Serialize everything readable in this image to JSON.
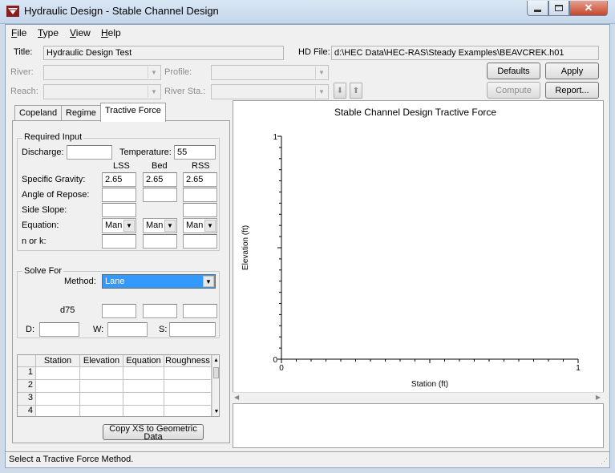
{
  "window": {
    "title": "Hydraulic Design - Stable Channel Design"
  },
  "menu": [
    {
      "label": "File"
    },
    {
      "label": "Type"
    },
    {
      "label": "View"
    },
    {
      "label": "Help"
    }
  ],
  "header": {
    "title_label": "Title:",
    "title_value": "Hydraulic Design Test",
    "hd_file_label": "HD File:",
    "hd_file_value": "d:\\HEC Data\\HEC-RAS\\Steady Examples\\BEAVCREK.h01",
    "river_label": "River:",
    "profile_label": "Profile:",
    "reach_label": "Reach:",
    "river_sta_label": "River Sta.:"
  },
  "buttons": {
    "defaults": "Defaults",
    "apply": "Apply",
    "compute": "Compute",
    "report": "Report..."
  },
  "tabs": [
    {
      "label": "Copeland"
    },
    {
      "label": "Regime"
    },
    {
      "label": "Tractive Force"
    }
  ],
  "required_input": {
    "group_title": "Required Input",
    "discharge_label": "Discharge:",
    "discharge_value": "",
    "temperature_label": "Temperature:",
    "temperature_value": "55",
    "col_lss": "LSS",
    "col_bed": "Bed",
    "col_rss": "RSS",
    "specific_gravity_label": "Specific Gravity:",
    "sg_lss": "2.65",
    "sg_bed": "2.65",
    "sg_rss": "2.65",
    "angle_label": "Angle of Repose:",
    "side_slope_label": "Side Slope:",
    "equation_label": "Equation:",
    "eq_lss": "Man",
    "eq_bed": "Man",
    "eq_rss": "Man",
    "n_or_k_label": "n or k:"
  },
  "solve_for": {
    "group_title": "Solve For",
    "method_label": "Method:",
    "method_value": "Lane",
    "d75_label": "d75",
    "d_label": "D:",
    "w_label": "W:",
    "s_label": "S:"
  },
  "grid": {
    "columns": [
      "Station",
      "Elevation",
      "Equation",
      "Roughness"
    ],
    "rows": [
      "1",
      "2",
      "3",
      "4"
    ]
  },
  "copy_button": "Copy XS to Geometric Data",
  "status": "Select a Tractive Force Method.",
  "chart_data": {
    "type": "line",
    "title": "Stable Channel Design Tractive Force",
    "xlabel": "Station (ft)",
    "ylabel": "Elevation (ft)",
    "xlim": [
      0,
      1
    ],
    "ylim": [
      0,
      1
    ],
    "x_tick_labels": [
      "0",
      "1"
    ],
    "y_tick_labels": [
      "0",
      "1"
    ],
    "series": []
  }
}
